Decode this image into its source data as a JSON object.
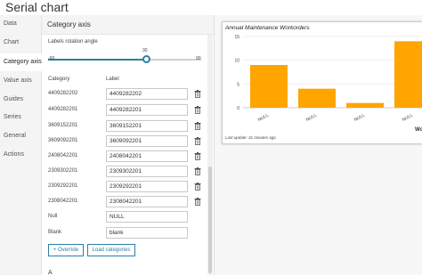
{
  "window": {
    "title": "Serial chart"
  },
  "nav": {
    "items": [
      {
        "label": "Data",
        "active": false
      },
      {
        "label": "Chart",
        "active": false
      },
      {
        "label": "Category axis",
        "active": true
      },
      {
        "label": "Value axis",
        "active": false
      },
      {
        "label": "Guides",
        "active": false
      },
      {
        "label": "Series",
        "active": false
      },
      {
        "label": "General",
        "active": false
      },
      {
        "label": "Actions",
        "active": false
      }
    ]
  },
  "panel": {
    "title": "Category axis",
    "rotation": {
      "label": "Labels rotation angle",
      "min": "-90",
      "max": "90",
      "value": "30",
      "value_num": 30
    },
    "columns": {
      "category": "Category",
      "label": "Label"
    },
    "rows": [
      {
        "category": "4409282202",
        "label": "4409282202",
        "deletable": true
      },
      {
        "category": "4409282201",
        "label": "4409282201",
        "deletable": true
      },
      {
        "category": "3609152201",
        "label": "3609152201",
        "deletable": true
      },
      {
        "category": "3609092201",
        "label": "3609092201",
        "deletable": true
      },
      {
        "category": "2408042201",
        "label": "2408042201",
        "deletable": true
      },
      {
        "category": "2309302201",
        "label": "2309302201",
        "deletable": true
      },
      {
        "category": "2309292201",
        "label": "2309292201",
        "deletable": true
      },
      {
        "category": "2308042201",
        "label": "2308042201",
        "deletable": true
      },
      {
        "category": "Null",
        "label": "NULL",
        "deletable": false
      },
      {
        "category": "Blank",
        "label": "blank",
        "deletable": false
      }
    ],
    "buttons": {
      "override": "+ Override",
      "load": "Load categories"
    },
    "next_section": "A"
  },
  "colors": {
    "accent": "#2d7fa5",
    "bar": "#ffa500"
  },
  "preview": {
    "footer": "Last update: 31 minutes ago"
  },
  "chart_data": {
    "type": "bar",
    "title": "Annual Maintenance Workorders",
    "categories": [
      "NULL",
      "NULL",
      "NULL",
      "NULL"
    ],
    "values": [
      9,
      4,
      1,
      14
    ],
    "ylim": [
      0,
      15
    ],
    "yticks": [
      0,
      5,
      10,
      15
    ],
    "xlabel": "Worke",
    "ylabel": "",
    "grid": true
  }
}
